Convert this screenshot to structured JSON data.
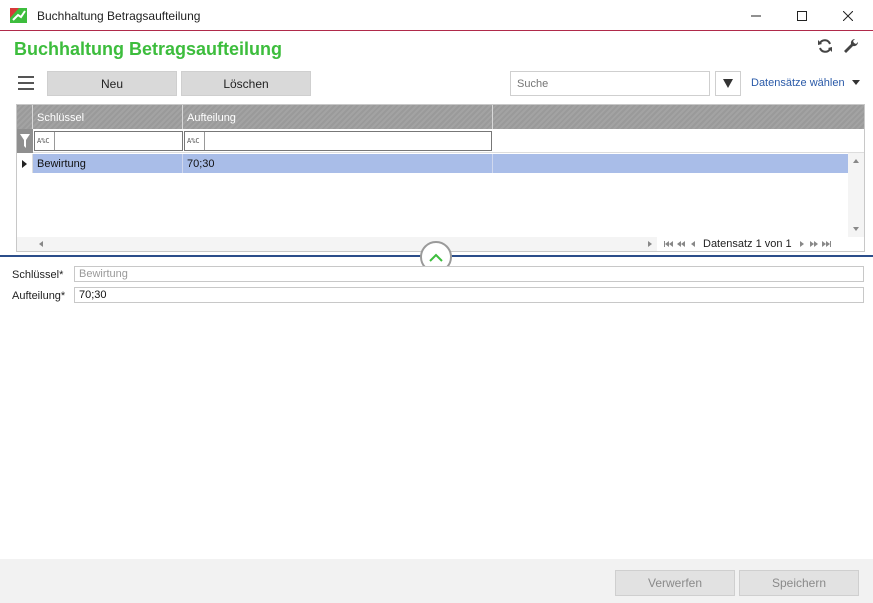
{
  "window": {
    "title": "Buchhaltung  Betragsaufteilung",
    "title_bar_accent": "#b02a4a"
  },
  "header": {
    "title": "Buchhaltung  Betragsaufteilung",
    "title_color": "#3dbd3d",
    "icons": [
      "refresh-icon",
      "wrench-icon"
    ]
  },
  "toolbar": {
    "new_label": "Neu",
    "delete_label": "Löschen",
    "search_placeholder": "Suche",
    "select_records_label": "Datensätze wählen"
  },
  "grid": {
    "columns": [
      "Schlüssel",
      "Aufteilung"
    ],
    "filter_operator": "A%C",
    "rows": [
      {
        "schluessel": "Bewirtung",
        "aufteilung": "70;30",
        "selected": true
      }
    ],
    "selected_row_color": "#a9bde8",
    "pager_text": "Datensatz 1 von 1"
  },
  "form": {
    "schluessel_label": "Schlüssel*",
    "schluessel_value": "Bewirtung",
    "aufteilung_label": "Aufteilung*",
    "aufteilung_value": "70;30"
  },
  "footer": {
    "discard_label": "Verwerfen",
    "save_label": "Speichern"
  }
}
